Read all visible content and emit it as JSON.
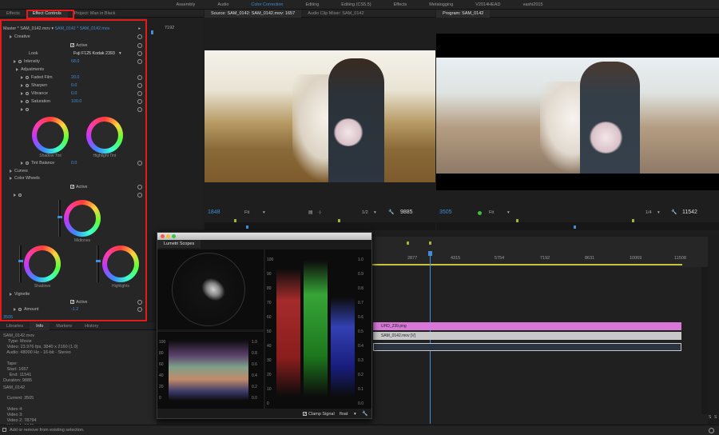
{
  "workspaces": [
    "Assembly",
    "Audio",
    "Color Correction",
    "Editing",
    "Editing (CS5.5)",
    "Effects",
    "Metalogging",
    "V2014HEAD",
    "vashi2015"
  ],
  "active_workspace": "Color Correction",
  "left_tabs": [
    "Effects",
    "Effect Controls",
    "Project: Man in Black"
  ],
  "ec": {
    "master": "Master * SAM_0142.mov",
    "clip": "SAM_0142 * SAM_0142.mov",
    "time": "7192",
    "creative": "Creative",
    "active": "Active",
    "look": "Look",
    "look_value": "Fuji F125 Kodak 2393",
    "intensity": "Intensity",
    "intensity_val": "68.0",
    "adjustments": "Adjustments",
    "faded": "Faded Film",
    "faded_val": "20.0",
    "sharpen": "Sharpen",
    "sharpen_val": "0.0",
    "vibrance": "Vibrance",
    "vibrance_val": "0.0",
    "saturation": "Saturation",
    "saturation_val": "100.0",
    "shadow_tint": "Shadow Tint",
    "highlight_tint": "Highlight Tint",
    "tint_balance": "Tint Balance",
    "tint_balance_val": "0.0",
    "curves": "Curves",
    "color_wheels": "Color Wheels",
    "midtones": "Midtones",
    "shadows": "Shadows",
    "highlights": "Highlights",
    "vignette": "Vignette",
    "amount": "Amount",
    "amount_val": "-1.2",
    "footer_time": "3505"
  },
  "source": {
    "tab": "Source: SAM_0142: SAM_0142.mov: 1657",
    "tab2": "Audio Clip Mixer: SAM_0142",
    "time": "1848",
    "fit": "Fit",
    "res": "1/2",
    "dur": "9885"
  },
  "program": {
    "tab": "Program: SAM_0142",
    "time": "3505",
    "fit": "Fit",
    "res": "1/4",
    "dur": "11542"
  },
  "scopes": {
    "title": "Lumetri Scopes",
    "clamp": "Clamp Signal",
    "float": "float",
    "left_ticks": [
      "100",
      "80",
      "60",
      "40",
      "20",
      "0"
    ],
    "right_ticks": [
      "1.0",
      "0.8",
      "0.6",
      "0.4",
      "0.2",
      "0.0"
    ],
    "parade_left": [
      "100",
      "90",
      "80",
      "70",
      "60",
      "50",
      "40",
      "30",
      "20",
      "10",
      "0"
    ],
    "parade_right": [
      "1.0",
      "0.9",
      "0.8",
      "0.7",
      "0.6",
      "0.5",
      "0.4",
      "0.3",
      "0.2",
      "0.1",
      "0.0"
    ]
  },
  "timeline": {
    "ruler": [
      "2877",
      "4315",
      "5754",
      "7192",
      "8631",
      "10069",
      "11508"
    ],
    "clips": [
      "UHD_239.png",
      "SAM_0142.mov [V]"
    ]
  },
  "info_tabs": [
    "Libraries",
    "Info",
    "Markers",
    "History"
  ],
  "info": {
    "name": "SAM_0142.mov",
    "lines": "    Type: Movie\n   Video: 23.976 fps, 3840 x 2160 (1.0)\n   Audio: 48000 Hz - 16-bit - Stereo\n\n   Tape:\n   Start: 1657\n     End: 11541\nDuration: 9885",
    "seq": "SAM_0142",
    "seq_lines": "   Current: 3505\n\n   Video 4:\n   Video 3:\n   Video 2: 78794\n   Video 1: 1848"
  },
  "status": "Add or remove from existing selection.",
  "meter": [
    "S",
    "S"
  ]
}
